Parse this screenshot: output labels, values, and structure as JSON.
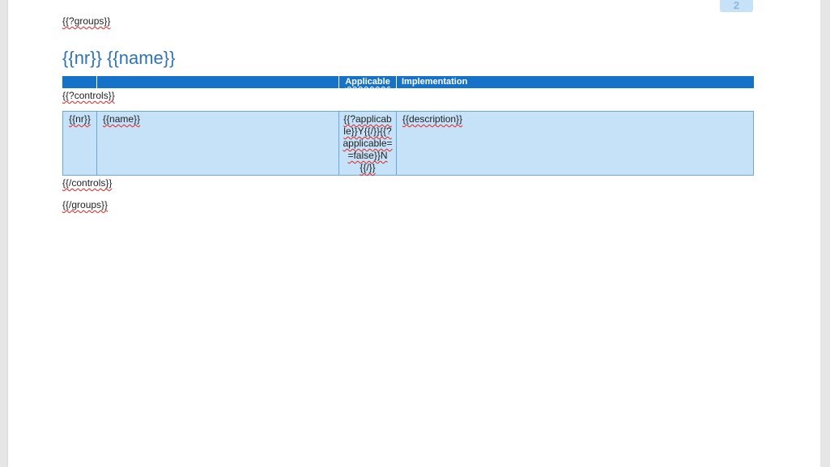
{
  "document": {
    "page_number": "2",
    "groups_open": "{{?groups}}",
    "heading": "{{nr}} {{name}}",
    "controls_open": "{{?controls}}",
    "controls_close": "{{/controls}}",
    "groups_close": "{{/groups}}"
  },
  "table": {
    "headers": [
      "",
      "",
      "Applicable",
      "Implementation"
    ],
    "row": {
      "nr": "{{nr}}",
      "name": "{{name}}",
      "applicable": "{{?applicable}}Y{{/}}{{?applicable==false}}N{{/}}",
      "description": "{{description}}"
    }
  },
  "colors": {
    "header_bg": "#1672c8",
    "row_bg": "#c5e2f8",
    "heading": "#2e74b5",
    "spellcheck": "#e02020"
  }
}
